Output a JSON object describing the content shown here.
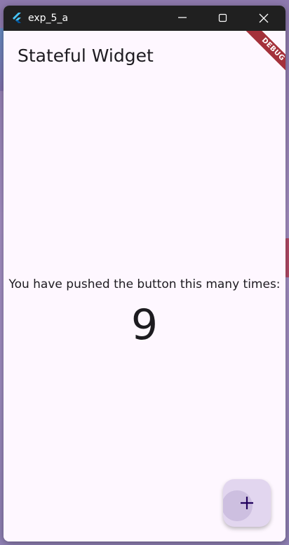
{
  "window": {
    "title": "exp_5_a",
    "controls": {
      "minimize_icon": "minimize-icon",
      "maximize_icon": "maximize-icon",
      "close_icon": "close-icon"
    }
  },
  "app": {
    "appbar_title": "Stateful Widget",
    "debug_banner": "DEBUG",
    "counter_label": "You have pushed the button this many times:",
    "counter_value": "9",
    "fab_icon": "plus-icon"
  },
  "colors": {
    "titlebar": "#202020",
    "background": "#fef7ff",
    "text": "#1d1b20",
    "fab": "#e2d6ef",
    "fab_icon": "#21005d",
    "debug_ribbon": "#a4313b"
  }
}
